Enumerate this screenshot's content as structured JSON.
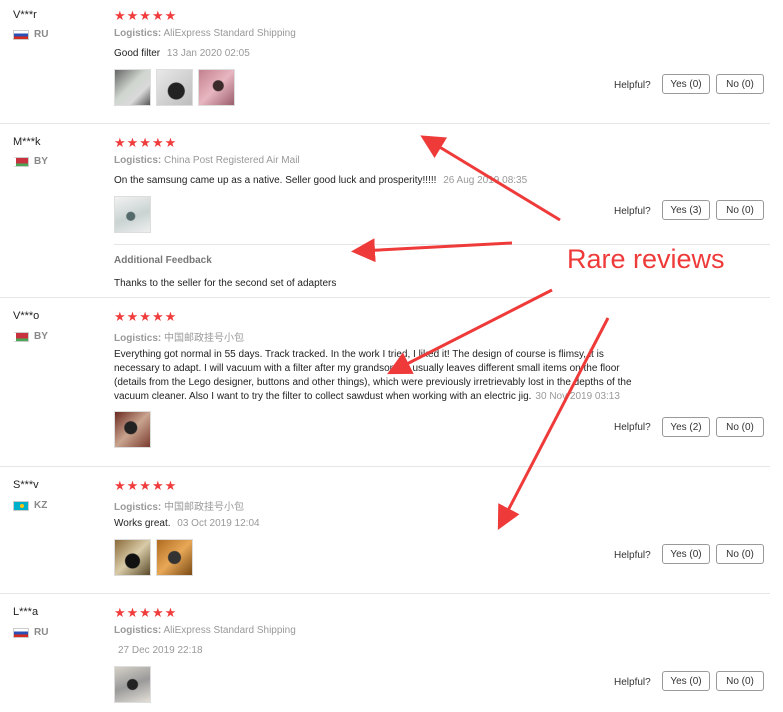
{
  "reviews": [
    {
      "user": "V***r",
      "country": "RU",
      "flag": "ru",
      "stars": "★★★★★",
      "logistics_label": "Logistics:",
      "logistics": "AliExpress Standard Shipping",
      "text": "Good filter",
      "date": "13 Jan 2020 02:05",
      "helpful": "Helpful?",
      "yes": "Yes (0)",
      "no": "No (0)"
    },
    {
      "user": "M***k",
      "country": "BY",
      "flag": "by",
      "stars": "★★★★★",
      "logistics_label": "Logistics:",
      "logistics": "China Post Registered Air Mail",
      "text": "On the samsung came up as a native. Seller good luck and prosperity!!!!!",
      "date": "26 Aug 2019 08:35",
      "helpful": "Helpful?",
      "yes": "Yes (3)",
      "no": "No (0)",
      "additional_title": "Additional Feedback",
      "additional_text": "Thanks to the seller for the second set of adapters"
    },
    {
      "user": "V***o",
      "country": "BY",
      "flag": "by",
      "stars": "★★★★★",
      "logistics_label": "Logistics:",
      "logistics": "中国邮政挂号小包",
      "text_lines": [
        "Everything got normal in 55 days. Track tracked. In the work I tried, I liked it! The design of course is flimsy, it is",
        "necessary to adapt. I will vacuum with a filter after my grandson-he usually leaves different small items on the floor",
        "(details from the Lego designer, buttons and other things), which were previously irretrievably lost in the depths of the",
        "vacuum cleaner. Also I want to try the filter to collect sawdust when working with an electric jig."
      ],
      "date": "30 Nov 2019 03:13",
      "helpful": "Helpful?",
      "yes": "Yes (2)",
      "no": "No (0)"
    },
    {
      "user": "S***v",
      "country": "KZ",
      "flag": "kz",
      "stars": "★★★★★",
      "logistics_label": "Logistics:",
      "logistics": "中国邮政挂号小包",
      "text": "Works great.",
      "date": "03 Oct 2019 12:04",
      "helpful": "Helpful?",
      "yes": "Yes (0)",
      "no": "No (0)"
    },
    {
      "user": "L***a",
      "country": "RU",
      "flag": "ru",
      "stars": "★★★★★",
      "logistics_label": "Logistics:",
      "logistics": "AliExpress Standard Shipping",
      "text": "",
      "date": "27 Dec 2019 22:18",
      "helpful": "Helpful?",
      "yes": "Yes (0)",
      "no": "No (0)"
    }
  ],
  "annotation": "Rare reviews",
  "colors": {
    "star": "#f03c3c",
    "annotation": "#ef3a3a"
  }
}
